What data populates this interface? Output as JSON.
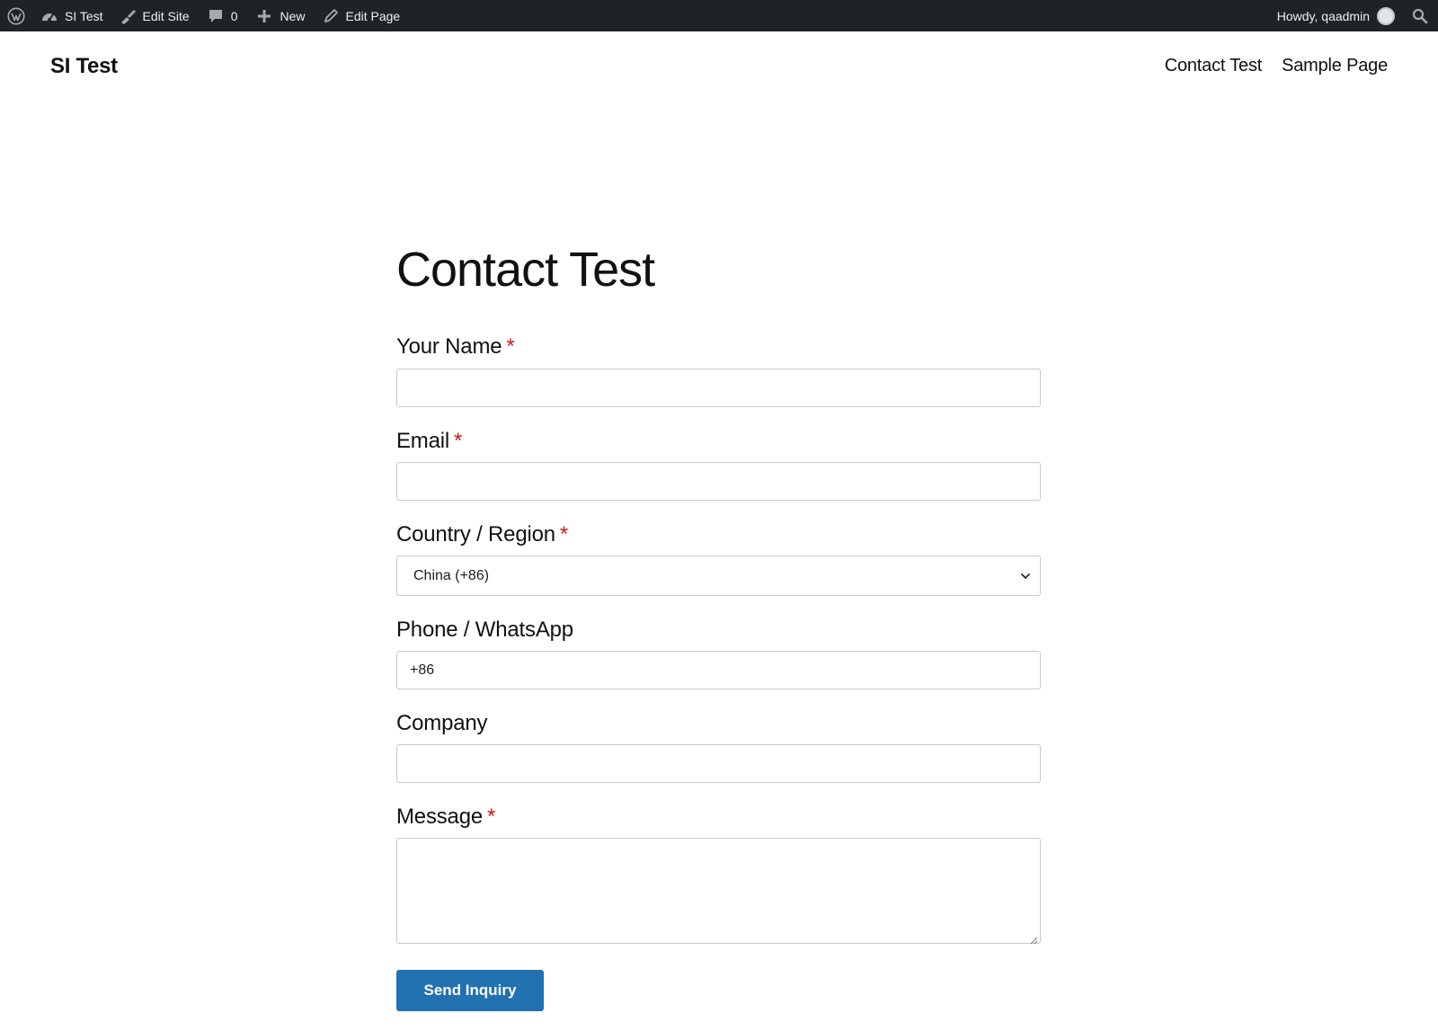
{
  "admin_bar": {
    "wp_logo_icon": "wordpress-logo-icon",
    "site_name": "SI Test",
    "edit_site": "Edit Site",
    "comments_count": "0",
    "new_label": "New",
    "edit_page": "Edit Page",
    "howdy": "Howdy, qaadmin"
  },
  "header": {
    "site_title": "SI Test",
    "nav": [
      "Contact Test",
      "Sample Page"
    ]
  },
  "page": {
    "title": "Contact Test"
  },
  "form": {
    "required_mark": "*",
    "name": {
      "label": "Your Name",
      "value": ""
    },
    "email": {
      "label": "Email",
      "value": ""
    },
    "country": {
      "label": "Country / Region",
      "selected": "China (+86)"
    },
    "phone": {
      "label": "Phone / WhatsApp",
      "value": "+86"
    },
    "company": {
      "label": "Company",
      "value": ""
    },
    "message": {
      "label": "Message",
      "value": ""
    },
    "submit_label": "Send Inquiry"
  },
  "colors": {
    "admin_bar_bg": "#1d2327",
    "button_bg": "#2271b1",
    "required": "#cc1818"
  }
}
